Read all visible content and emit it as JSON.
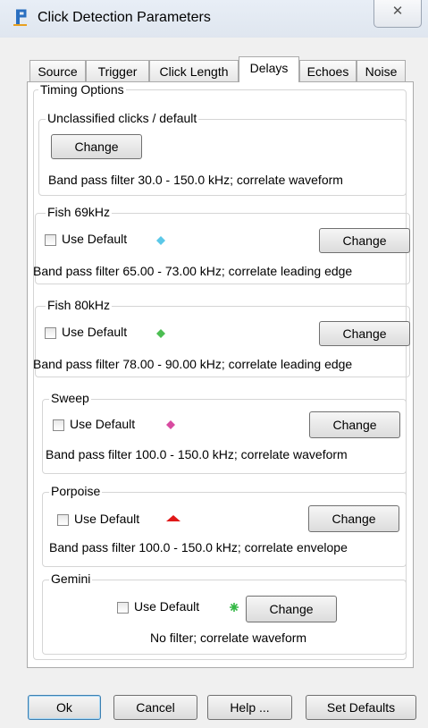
{
  "window": {
    "title": "Click Detection Parameters",
    "close_glyph": "✕"
  },
  "tabs": [
    {
      "label": "Source"
    },
    {
      "label": "Trigger"
    },
    {
      "label": "Click Length"
    },
    {
      "label": "Delays",
      "active": true
    },
    {
      "label": "Echoes"
    },
    {
      "label": "Noise"
    }
  ],
  "timing_options": {
    "title": "Timing Options"
  },
  "groups": [
    {
      "title": "Unclassified clicks / default",
      "button": "Change",
      "description": "Band pass filter 30.0 - 150.0 kHz; correlate waveform"
    },
    {
      "title": "Fish 69kHz",
      "checkbox_label": "Use Default",
      "checked": false,
      "symbol_color": "#5bc8e8",
      "symbol": "diamond-icon",
      "button": "Change",
      "description": "Band pass filter 65.00 - 73.00 kHz; correlate leading edge"
    },
    {
      "title": "Fish 80kHz",
      "checkbox_label": "Use Default",
      "checked": false,
      "symbol_color": "#4cbe52",
      "symbol": "diamond-icon",
      "button": "Change",
      "description": "Band pass filter 78.00 - 90.00 kHz; correlate leading edge"
    },
    {
      "title": "Sweep",
      "checkbox_label": "Use Default",
      "checked": false,
      "symbol_color": "#d84aa0",
      "symbol": "diamond-icon",
      "button": "Change",
      "description": "Band pass filter 100.0 - 150.0 kHz; correlate waveform"
    },
    {
      "title": "Porpoise",
      "checkbox_label": "Use Default",
      "checked": false,
      "symbol_color": "#e01818",
      "symbol": "triangle-icon",
      "button": "Change",
      "description": "Band pass filter 100.0 - 150.0 kHz; correlate envelope"
    },
    {
      "title": "Gemini",
      "checkbox_label": "Use Default",
      "checked": false,
      "symbol_color": "#34b845",
      "symbol": "star-icon",
      "button": "Change",
      "description": "No filter; correlate waveform"
    }
  ],
  "footer": {
    "ok": "Ok",
    "cancel": "Cancel",
    "help": "Help ...",
    "set_defaults": "Set Defaults"
  }
}
